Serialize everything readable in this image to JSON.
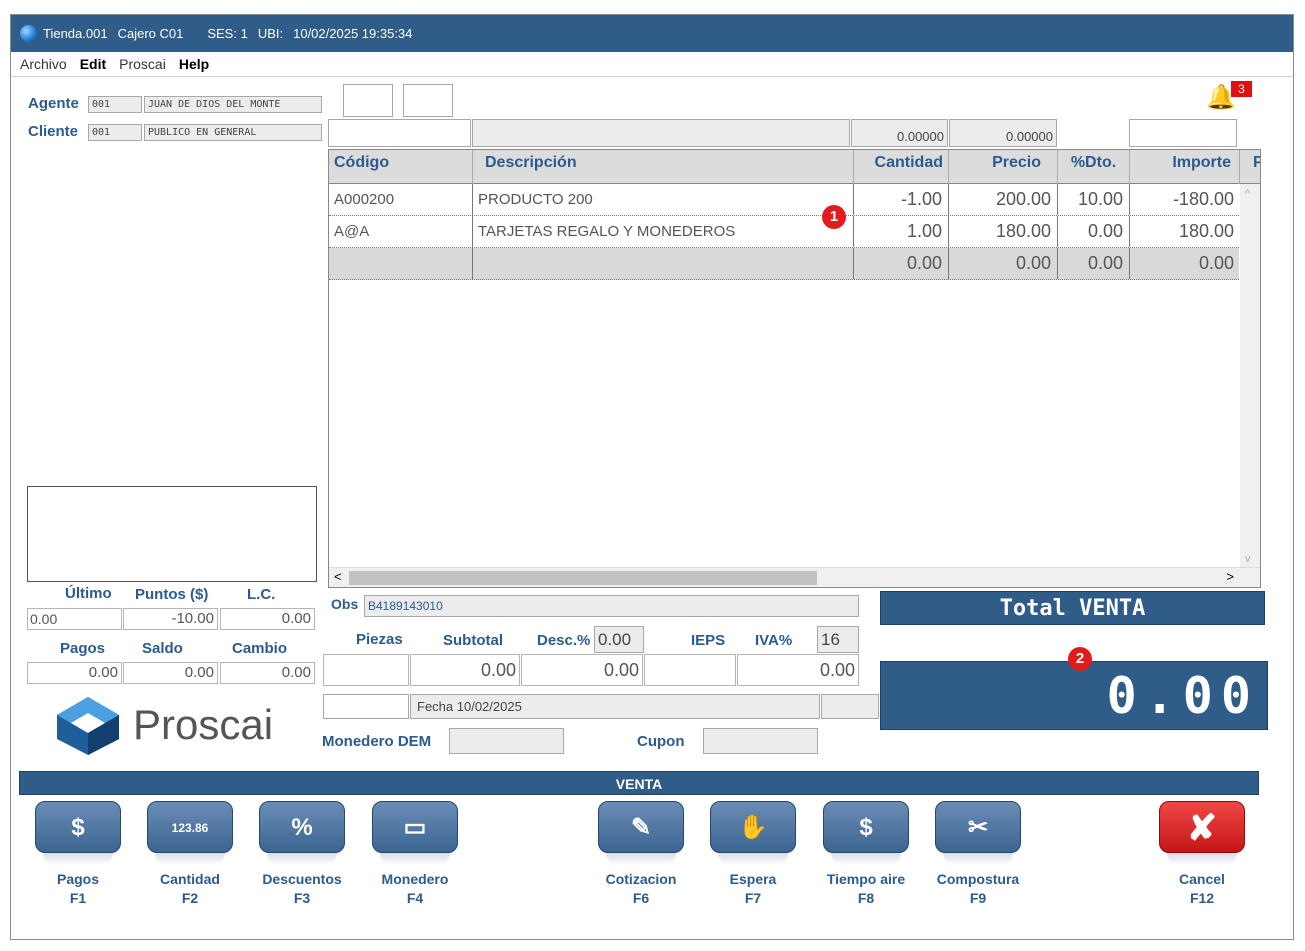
{
  "titlebar": {
    "store": "Tienda.001",
    "cashier": "Cajero C01",
    "session": "SES: 1",
    "ubi": "UBI:",
    "datetime": "10/02/2025 19:35:34"
  },
  "menu": [
    "Archivo",
    "Edit",
    "Proscai",
    "Help"
  ],
  "agent": {
    "label": "Agente",
    "code": "001",
    "name": "JUAN DE DIOS DEL MONTE"
  },
  "client": {
    "label": "Cliente",
    "code": "001",
    "name": "PUBLICO EN GENERAL"
  },
  "notifications": {
    "count": "3"
  },
  "top_values": {
    "v1": "0.00000",
    "v2": "0.00000"
  },
  "grid": {
    "headers": [
      "Código",
      "Descripción",
      "Cantidad",
      "Precio",
      "%Dto.",
      "Importe",
      "P"
    ],
    "rows": [
      [
        "A000200",
        "PRODUCTO 200",
        "-1.00",
        "200.00",
        "10.00",
        "-180.00"
      ],
      [
        "A@A",
        "TARJETAS REGALO Y MONEDEROS",
        "1.00",
        "180.00",
        "0.00",
        "180.00"
      ],
      [
        "",
        "",
        "0.00",
        "0.00",
        "0.00",
        "0.00"
      ]
    ]
  },
  "callouts": {
    "c1": "1",
    "c2": "2"
  },
  "left_stats": {
    "labels1": [
      "Último",
      "Puntos ($)",
      "L.C."
    ],
    "values1": [
      "0.00",
      "-10.00",
      "0.00"
    ],
    "labels2": [
      "Pagos",
      "Saldo",
      "Cambio"
    ],
    "values2": [
      "0.00",
      "0.00",
      "0.00"
    ]
  },
  "logo": {
    "text": "Proscai"
  },
  "obs": {
    "label": "Obs",
    "value": "B4189143010"
  },
  "summary": {
    "piezas_label": "Piezas",
    "subtotal_label": "Subtotal",
    "desc_label": "Desc.%",
    "desc_value": "0.00",
    "ieps_label": "IEPS",
    "iva_label": "IVA%",
    "iva_value": "16",
    "subtotal": "0.00",
    "descuento": "0.00",
    "ieps": "0.00"
  },
  "fecha": "Fecha 10/02/2025",
  "monedero_label": "Monedero DEM",
  "cupon_label": "Cupon",
  "total": {
    "label": "Total VENTA",
    "value": "0.00"
  },
  "mode_bar": "VENTA",
  "fkeys": [
    {
      "name": "Pagos",
      "key": "F1",
      "icon": "$"
    },
    {
      "name": "Cantidad",
      "key": "F2",
      "icon": "123.86"
    },
    {
      "name": "Descuentos",
      "key": "F3",
      "icon": "%"
    },
    {
      "name": "Monedero",
      "key": "F4",
      "icon": "▭"
    },
    {
      "name": "Cotizacion",
      "key": "F6",
      "icon": "✎"
    },
    {
      "name": "Espera",
      "key": "F7",
      "icon": "✋"
    },
    {
      "name": "Tiempo aire",
      "key": "F8",
      "icon": "$"
    },
    {
      "name": "Compostura",
      "key": "F9",
      "icon": "✂"
    },
    {
      "name": "Cancel",
      "key": "F12",
      "icon": "✘"
    }
  ]
}
